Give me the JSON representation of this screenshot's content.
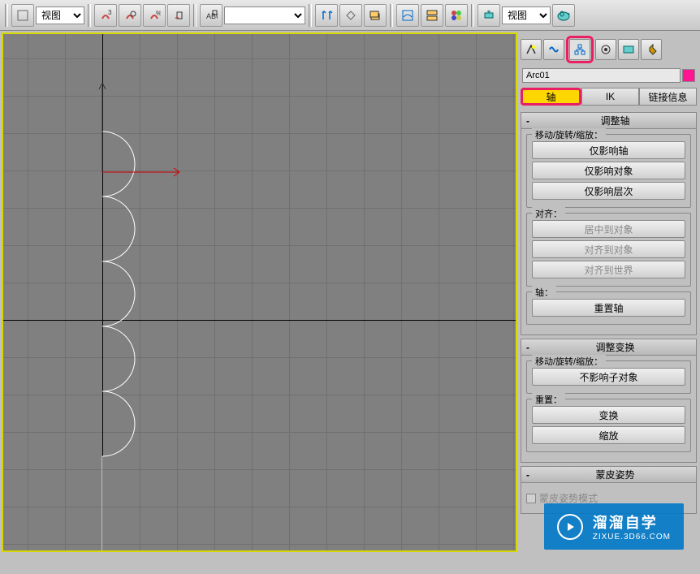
{
  "toolbar": {
    "view_dropdown1": "视图",
    "view_dropdown2": "视图",
    "empty_dropdown": ""
  },
  "panel": {
    "object_name": "Arc01",
    "tabs": {
      "pivot": "轴",
      "ik": "IK",
      "link_info": "链接信息"
    },
    "rollouts": {
      "adjust_pivot": {
        "title": "调整轴",
        "group_move": "移动/旋转/缩放：",
        "affect_pivot": "仅影响轴",
        "affect_object": "仅影响对象",
        "affect_hierarchy": "仅影响层次",
        "group_align": "对齐：",
        "center_to_object": "居中到对象",
        "align_to_object": "对齐到对象",
        "align_to_world": "对齐到世界",
        "group_pivot": "轴：",
        "reset_pivot": "重置轴"
      },
      "adjust_transform": {
        "title": "调整变换",
        "group_move": "移动/旋转/缩放：",
        "dont_affect_children": "不影响子对象",
        "group_reset": "重置：",
        "transform": "变换",
        "scale": "缩放"
      },
      "skin_pose": {
        "title": "蒙皮姿势",
        "skin_pose_mode": "蒙皮姿势模式"
      }
    }
  },
  "watermark": {
    "title": "溜溜自学",
    "url": "ZIXUE.3D66.COM"
  }
}
